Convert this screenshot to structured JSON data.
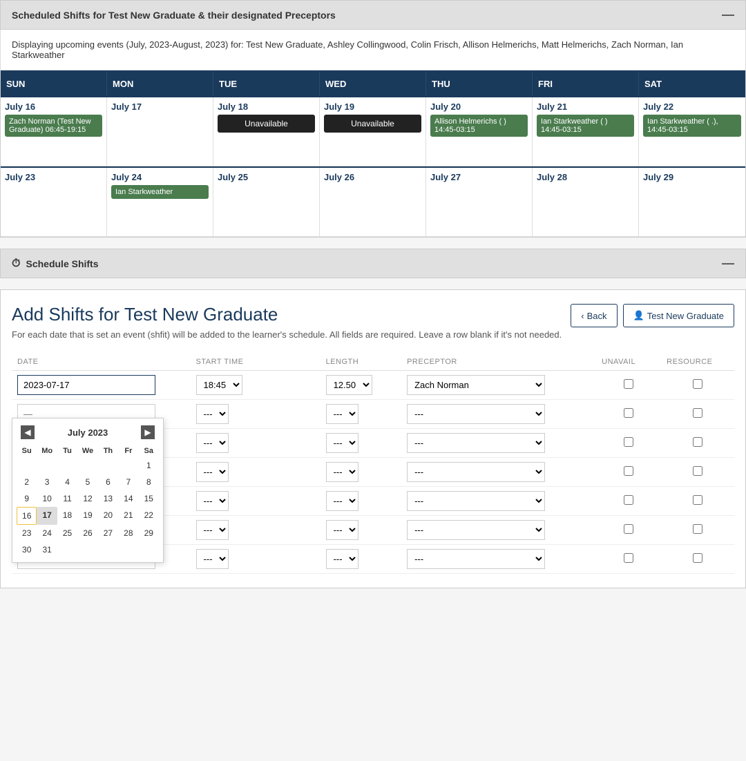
{
  "scheduled_shifts_section": {
    "title": "Scheduled Shifts for Test New Graduate & their designated Preceptors",
    "minimize": "—",
    "info_text": "Displaying upcoming events (July, 2023-August, 2023) for: Test New Graduate, Ashley Collingwood, Colin Frisch, Allison Helmerichs, Matt Helmerichs, Zach Norman, Ian Starkweather"
  },
  "calendar": {
    "headers": [
      "SUN",
      "MON",
      "TUE",
      "WED",
      "THU",
      "FRI",
      "SAT"
    ],
    "weeks": [
      [
        {
          "date": "July 16",
          "events": [
            {
              "type": "green",
              "text": "Zach Norman (Test New Graduate) 06:45-19:15"
            }
          ]
        },
        {
          "date": "July 17",
          "events": []
        },
        {
          "date": "July 18",
          "events": [
            {
              "type": "black",
              "text": "Unavailable"
            }
          ]
        },
        {
          "date": "July 19",
          "events": [
            {
              "type": "black",
              "text": "Unavailable"
            }
          ]
        },
        {
          "date": "July 20",
          "events": [
            {
              "type": "green",
              "text": "Allison Helmerichs (        ) 14:45-03:15"
            }
          ]
        },
        {
          "date": "July 21",
          "events": [
            {
              "type": "green",
              "text": "Ian Starkweather (        ) 14:45-03:15"
            }
          ]
        },
        {
          "date": "July 22",
          "events": [
            {
              "type": "green",
              "text": "Ian Starkweather (        .), 14:45-03:15"
            }
          ]
        }
      ],
      [
        {
          "date": "July 23",
          "events": []
        },
        {
          "date": "July 24",
          "events": [
            {
              "type": "green",
              "text": "Ian Starkweather"
            }
          ]
        },
        {
          "date": "July 25",
          "events": []
        },
        {
          "date": "July 26",
          "events": []
        },
        {
          "date": "July 27",
          "events": []
        },
        {
          "date": "July 28",
          "events": []
        },
        {
          "date": "July 29",
          "events": []
        }
      ]
    ]
  },
  "schedule_shifts_section": {
    "title": "Schedule Shifts",
    "minimize": "—"
  },
  "add_shifts": {
    "title": "Add Shifts for Test New Graduate",
    "description": "For each date that is set an event (shfit) will be added to the learner's schedule. All fields are required. Leave a row blank if it's not needed.",
    "back_button": "Back",
    "user_button": "Test New Graduate",
    "table_headers": {
      "date": "DATE",
      "start_time": "START TIME",
      "length": "LENGTH",
      "preceptor": "PRECEPTOR",
      "unavail": "UNAVAIL",
      "resource": "RESOURCE"
    },
    "rows": [
      {
        "date": "2023-07-17",
        "start_time": "18:45",
        "length": "12.50",
        "preceptor": "Zach Norman"
      },
      {
        "date": "",
        "start_time": "---",
        "length": "---",
        "preceptor": "---"
      },
      {
        "date": "",
        "start_time": "---",
        "length": "---",
        "preceptor": "---"
      },
      {
        "date": "",
        "start_time": "---",
        "length": "---",
        "preceptor": "---"
      },
      {
        "date": "",
        "start_time": "---",
        "length": "---",
        "preceptor": "---"
      },
      {
        "date": "",
        "start_time": "---",
        "length": "---",
        "preceptor": "---"
      },
      {
        "date": "",
        "start_time": "---",
        "length": "---",
        "preceptor": "---"
      }
    ]
  },
  "datepicker": {
    "month_label": "July 2023",
    "days_of_week": [
      "Su",
      "Mo",
      "Tu",
      "We",
      "Th",
      "Fr",
      "Sa"
    ],
    "weeks": [
      [
        null,
        null,
        null,
        null,
        null,
        null,
        1
      ],
      [
        2,
        3,
        4,
        5,
        6,
        7,
        8
      ],
      [
        9,
        10,
        11,
        12,
        13,
        14,
        15
      ],
      [
        16,
        17,
        18,
        19,
        20,
        21,
        22
      ],
      [
        23,
        24,
        25,
        26,
        27,
        28,
        29
      ],
      [
        30,
        31,
        null,
        null,
        null,
        null,
        null
      ]
    ],
    "today": 16,
    "selected": 17
  }
}
